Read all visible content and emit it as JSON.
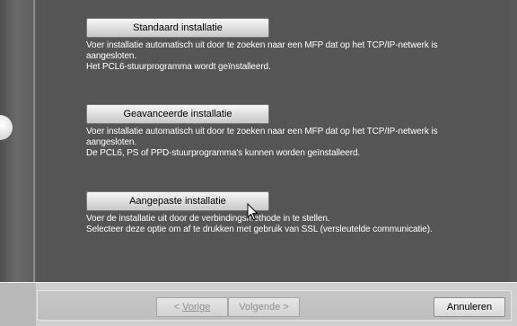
{
  "options": [
    {
      "button_label": "Standaard installatie",
      "description_lines": [
        "Voer installatie automatisch uit door te zoeken naar een MFP dat op het TCP/IP-netwerk is",
        "aangesloten.",
        "Het PCL6-stuurprogramma wordt geïnstalleerd."
      ]
    },
    {
      "button_label": "Geavanceerde installatie",
      "description_lines": [
        "Voer installatie automatisch uit door te zoeken naar een MFP dat op het TCP/IP-netwerk is",
        "aangesloten.",
        "De PCL6, PS of PPD-stuurprogramma's kunnen worden geïnstalleerd."
      ]
    },
    {
      "button_label": "Aangepaste installatie",
      "description_lines": [
        "Voer de installatie uit door de verbindingsmethode in te stellen.",
        "Selecteer deze optie om af te drukken met gebruik van SSL (versleutelde communicatie)."
      ]
    }
  ],
  "footer": {
    "back_prefix": "< ",
    "back_label": "Vorige",
    "next_label": "Volgende >",
    "cancel_label": "Annuleren"
  },
  "icons": {
    "pointer": "mouse-pointer-icon",
    "left_arrow": "side-arrow-icon"
  }
}
